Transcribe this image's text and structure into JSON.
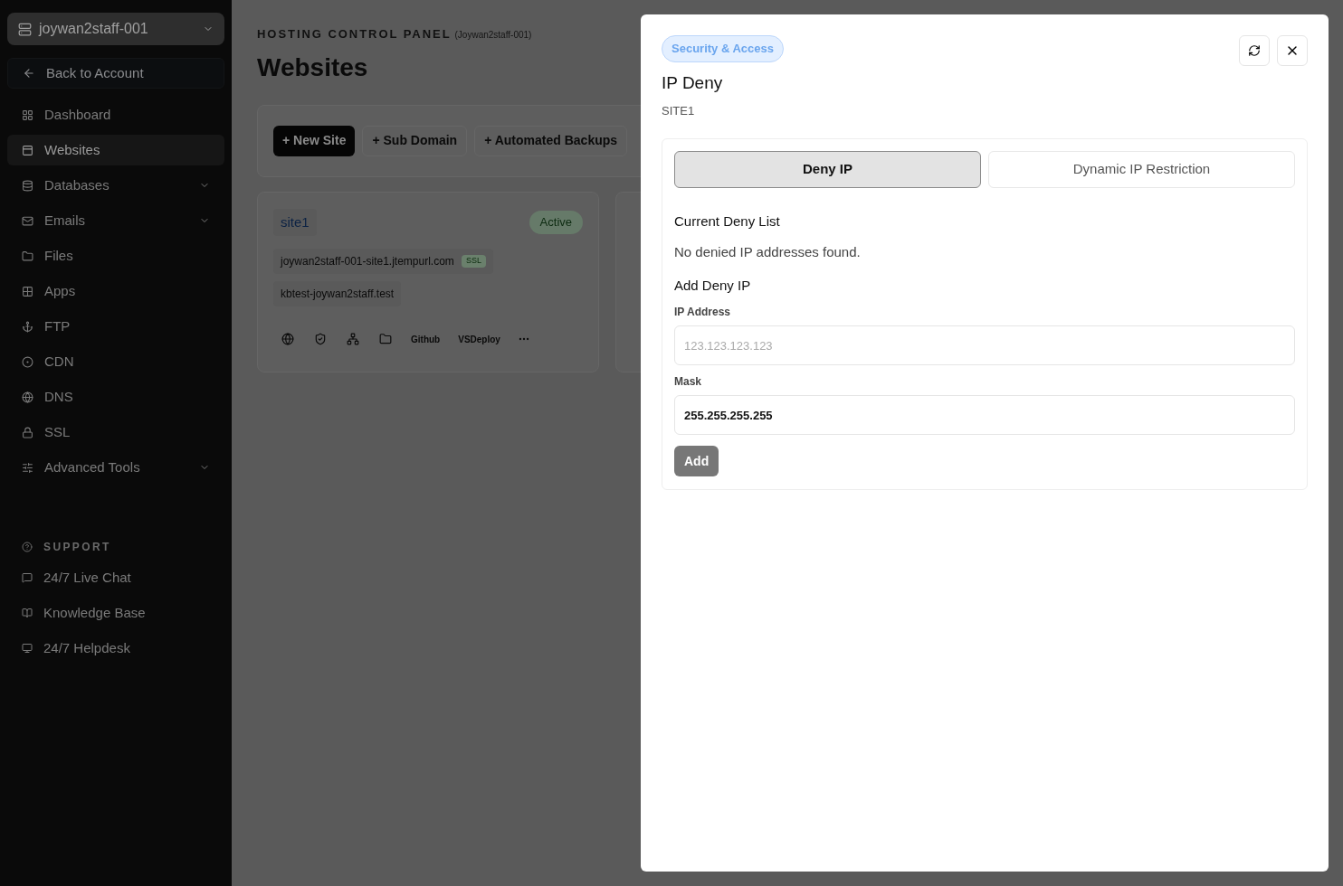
{
  "sidebar": {
    "account_switcher": "joywan2staff-001",
    "back_link": "Back to Account",
    "items": [
      {
        "label": "Dashboard",
        "selected": false,
        "has_submenu": false
      },
      {
        "label": "Websites",
        "selected": true,
        "has_submenu": false
      },
      {
        "label": "Databases",
        "selected": false,
        "has_submenu": true
      },
      {
        "label": "Emails",
        "selected": false,
        "has_submenu": true
      },
      {
        "label": "Files",
        "selected": false,
        "has_submenu": false
      },
      {
        "label": "Apps",
        "selected": false,
        "has_submenu": false
      },
      {
        "label": "FTP",
        "selected": false,
        "has_submenu": false
      },
      {
        "label": "CDN",
        "selected": false,
        "has_submenu": false
      },
      {
        "label": "DNS",
        "selected": false,
        "has_submenu": false
      },
      {
        "label": "SSL",
        "selected": false,
        "has_submenu": false
      },
      {
        "label": "Advanced Tools",
        "selected": false,
        "has_submenu": true
      }
    ],
    "support_heading": "SUPPORT",
    "support_items": [
      "24/7 Live Chat",
      "Knowledge Base",
      "24/7 Helpdesk"
    ]
  },
  "header": {
    "eyebrow": "HOSTING CONTROL PANEL",
    "account": "(Joywan2staff-001)",
    "title": "Websites"
  },
  "toolbar": [
    {
      "label": "+ New Site",
      "primary": true
    },
    {
      "label": "+ Sub Domain",
      "primary": false
    },
    {
      "label": "+ Automated Backups",
      "primary": false
    }
  ],
  "site_card": {
    "name": "site1",
    "status": "Active",
    "domains": [
      {
        "name": "joywan2staff-001-site1.jtempurl.com",
        "badge": "SSL"
      },
      {
        "name": "kbtest-joywan2staff.test"
      }
    ],
    "actions": [
      "Github",
      "VSDeploy"
    ]
  },
  "dialog": {
    "category": "Security & Access",
    "title": "IP Deny",
    "subtitle": "SITE1",
    "tabs": [
      {
        "label": "Deny IP",
        "selected": true
      },
      {
        "label": "Dynamic IP Restriction",
        "selected": false
      }
    ],
    "list_heading": "Current Deny List",
    "empty_message": "No denied IP addresses found.",
    "form_heading": "Add Deny IP",
    "fields": [
      {
        "label": "IP Address",
        "placeholder": "123.123.123.123"
      },
      {
        "label": "Mask",
        "value": "255.255.255.255"
      }
    ],
    "submit": "Add"
  }
}
